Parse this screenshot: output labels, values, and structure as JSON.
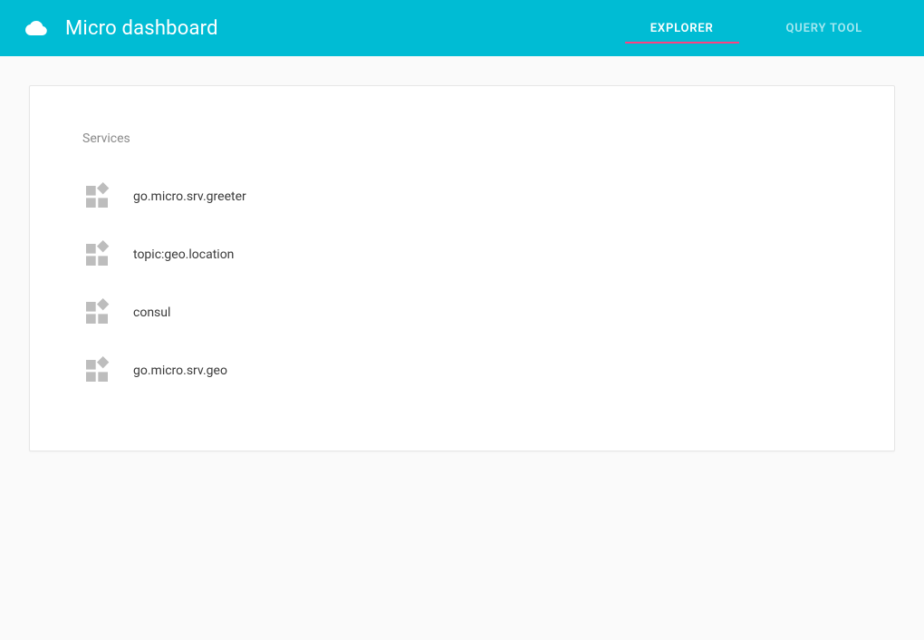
{
  "header": {
    "title": "Micro dashboard",
    "tabs": [
      {
        "label": "EXPLORER",
        "active": true
      },
      {
        "label": "QUERY TOOL",
        "active": false
      }
    ]
  },
  "main": {
    "section_title": "Services",
    "services": [
      {
        "name": "go.micro.srv.greeter"
      },
      {
        "name": "topic:geo.location"
      },
      {
        "name": "consul"
      },
      {
        "name": "go.micro.srv.geo"
      }
    ]
  }
}
